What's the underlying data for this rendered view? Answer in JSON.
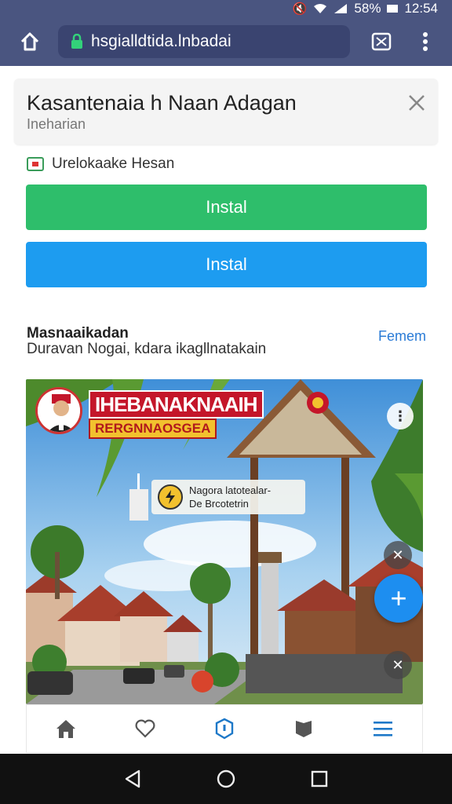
{
  "status_bar": {
    "battery": "58%",
    "time": "12:54"
  },
  "browser": {
    "url": "hsgialldtida.lnbadai"
  },
  "install_card": {
    "title": "Kasantenaia h Naan Adagan",
    "subtitle": "Ineharian"
  },
  "site": {
    "label": "Urelokaake Hesan"
  },
  "buttons": {
    "primary_label": "Instal",
    "secondary_label": "Instal"
  },
  "section": {
    "title": "Masnaaikadan",
    "subtitle": "Duravan Nogai, kdara ikagllnatakain",
    "link": "Femem"
  },
  "promo": {
    "title": "IHEBANAKNAAIH",
    "subtitle": "RERGNNAOSGEA",
    "info_line1": "Nagora latotealar-",
    "info_line2": "De Brcotetrin",
    "fab": "+"
  },
  "icons": {
    "home": "home-icon",
    "heart": "heart-icon",
    "notify": "notification-icon",
    "bookmark": "bookmark-icon",
    "menu": "menu-icon"
  },
  "colors": {
    "toolbar": "#4a5580",
    "install_green": "#2ebe6b",
    "install_blue": "#1d9cf0",
    "promo_red": "#c4162a",
    "fab_blue": "#1d8ef0"
  }
}
